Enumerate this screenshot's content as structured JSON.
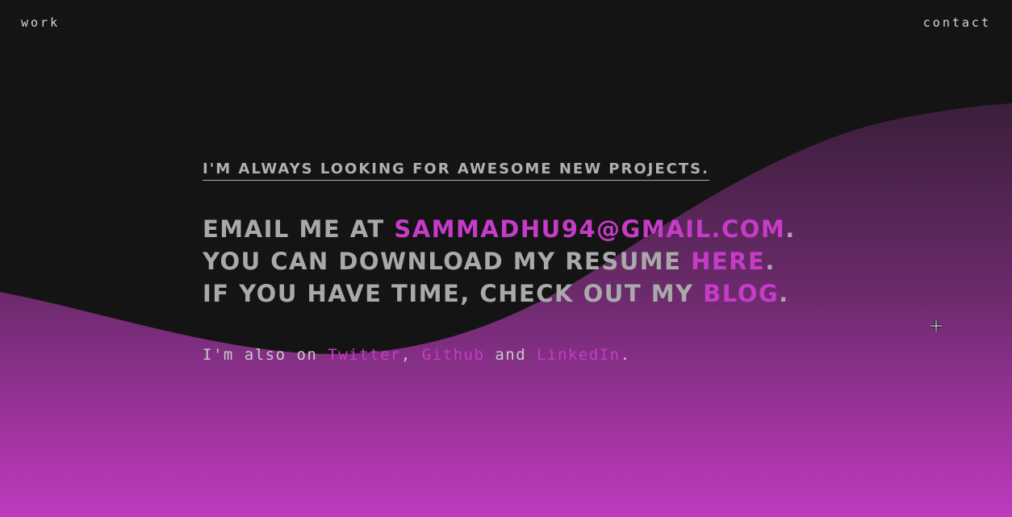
{
  "nav": {
    "work_label": "work",
    "contact_label": "contact"
  },
  "tagline": "I'm always looking for awesome new projects.",
  "lines": {
    "email_prefix": "Email me at ",
    "email": "sammadhu94@gmail.com",
    "email_suffix": ".",
    "resume_prefix": "You can download my resume ",
    "resume_link": "here",
    "resume_suffix": ".",
    "blog_prefix": "If you have time, check out my ",
    "blog_link": "blog",
    "blog_suffix": "."
  },
  "social": {
    "prefix": "I'm also on ",
    "twitter": "Twitter",
    "sep1": ", ",
    "github": "Github",
    "sep2": " and ",
    "linkedin": "LinkedIn",
    "suffix": "."
  },
  "colors": {
    "background": "#141414",
    "accent": "#c63bc8",
    "text": "#a9a9a9",
    "wave_top": "#3a1f3a",
    "wave_bottom": "#bf3abf"
  },
  "cursor_icon": "crosshair-cursor-icon"
}
